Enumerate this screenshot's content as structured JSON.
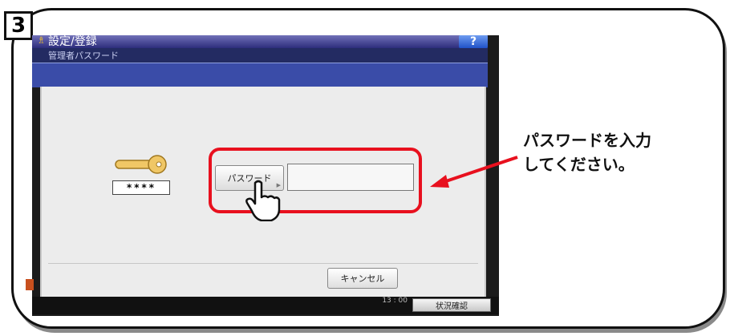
{
  "step": {
    "number": "3"
  },
  "device": {
    "title": "設定/登録",
    "help_label": "?",
    "subtitle": "管理者パスワード",
    "password_button": "パスワード",
    "password_value": "",
    "masked_display": "****",
    "cancel_button": "キャンセル",
    "status_button": "状況確認",
    "clock": "13 : 00"
  },
  "callout": {
    "line1": "パスワードを入力",
    "line2": "してください。"
  },
  "colors": {
    "highlight": "#e8101e",
    "title_bar": "#2d2d7c",
    "help_button": "#2052c8"
  },
  "icons": [
    "key-icon",
    "pointing-hand-icon",
    "home-icon",
    "arrow-icon"
  ]
}
